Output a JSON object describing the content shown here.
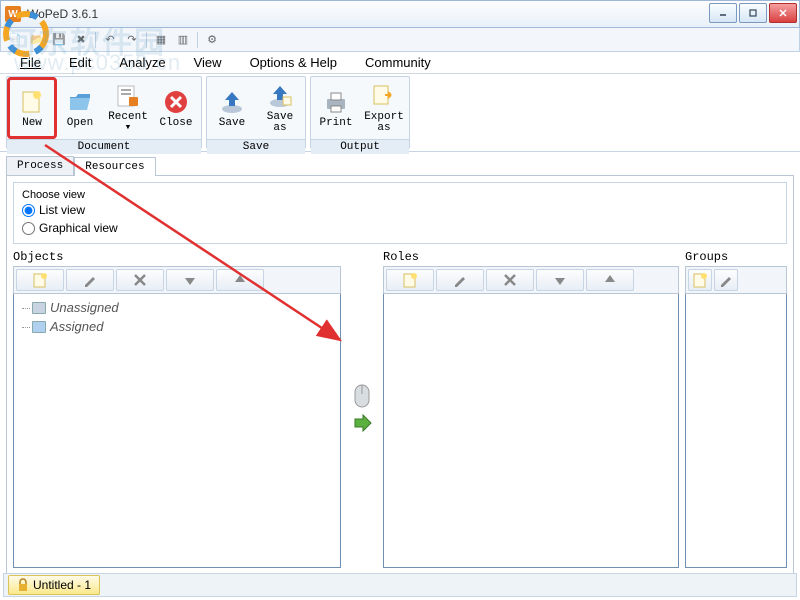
{
  "window": {
    "title": "WoPeD 3.6.1"
  },
  "menubar": {
    "file": "File",
    "edit": "Edit",
    "analyze": "Analyze",
    "view": "View",
    "options": "Options & Help",
    "community": "Community"
  },
  "ribbon": {
    "new": "New",
    "open": "Open",
    "recent": "Recent\n▾",
    "close": "Close",
    "save": "Save",
    "saveas": "Save\nas",
    "print": "Print",
    "exportas": "Export\nas",
    "group_document": "Document",
    "group_save": "Save",
    "group_output": "Output"
  },
  "tabs": {
    "process": "Process",
    "resources": "Resources"
  },
  "choose": {
    "legend": "Choose view",
    "list": "List view",
    "graphical": "Graphical view"
  },
  "columns": {
    "objects": "Objects",
    "roles": "Roles",
    "groups": "Groups"
  },
  "tree": {
    "unassigned": "Unassigned",
    "assigned": "Assigned"
  },
  "status": {
    "doc": "Untitled - 1"
  },
  "watermark": {
    "line1": "河东软件园",
    "line2": "www.pc0359.cn"
  },
  "icons": {
    "new": "new-file-icon",
    "pencil": "edit-icon",
    "delete": "delete-icon",
    "down": "arrow-down-icon",
    "up": "arrow-up-icon"
  }
}
